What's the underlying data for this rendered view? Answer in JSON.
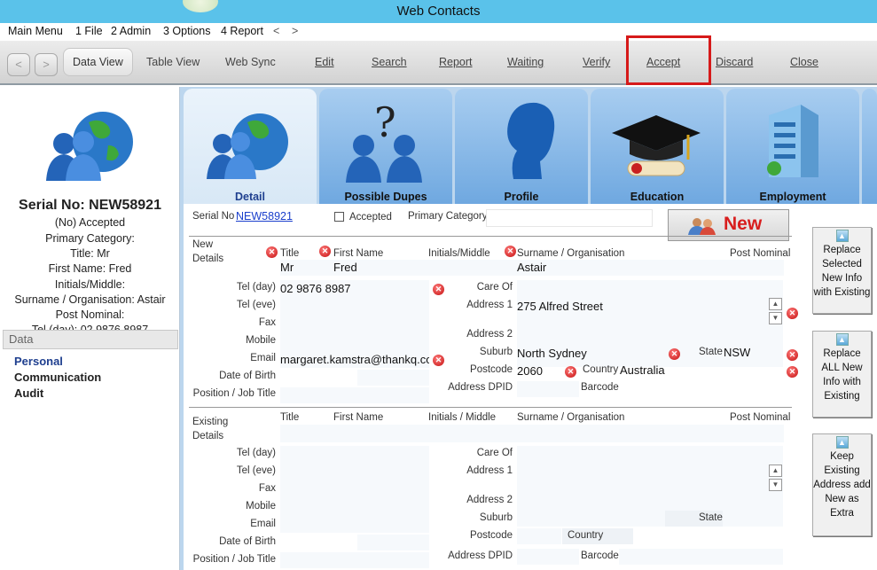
{
  "window": {
    "title": "Web Contacts"
  },
  "menu": [
    "Main Menu",
    "1 File",
    "2 Admin",
    "3 Options",
    "4 Report",
    "<",
    ">"
  ],
  "toolbar": {
    "back": "<",
    "forward": ">",
    "items": [
      "Data View",
      "Table View",
      "Web Sync",
      "Edit",
      "Search",
      "Report",
      "Waiting",
      "Verify",
      "Accept",
      "Discard",
      "Close"
    ]
  },
  "left": {
    "serial": "Serial No: NEW58921",
    "lines": [
      "(No) Accepted",
      "Primary Category:",
      "Title: Mr",
      "First Name: Fred",
      "Initials/Middle:",
      "Surname / Organisation: Astair",
      "Post Nominal:",
      "Tel (day): 02 9876 8987"
    ],
    "data_header": "Data",
    "nav": [
      "Personal",
      "Communication",
      "Audit"
    ]
  },
  "tabs": [
    "Detail",
    "Possible Dupes",
    "Profile",
    "Education",
    "Employment"
  ],
  "form": {
    "serial_label": "Serial No",
    "serial_value": "NEW58921",
    "accepted_label": "Accepted",
    "primary_category_label": "Primary Category",
    "new_button": "New",
    "new_details_label": "New\nDetails",
    "existing_details_label": "Existing\nDetails",
    "col_title": "Title",
    "col_first": "First Name",
    "col_initials": "Initials/Middle",
    "col_initials2": "Initials / Middle",
    "col_surname": "Surname / Organisation",
    "col_postnom": "Post Nominal",
    "title_val": "Mr",
    "first_val": "Fred",
    "surname_val": "Astair",
    "labels_left": [
      "Tel (day)",
      "Tel (eve)",
      "Fax",
      "Mobile",
      "Email",
      "Date of Birth",
      "Position / Job Title"
    ],
    "labels_right": [
      "Care Of",
      "Address 1",
      "Address 2",
      "Suburb",
      "State",
      "Postcode",
      "Country",
      "Address DPID",
      "Barcode"
    ],
    "tel_day": "02 9876 8987",
    "email": "margaret.kamstra@thankq.com",
    "address1": "275 Alfred Street",
    "suburb": "North Sydney",
    "state": "NSW",
    "postcode": "2060",
    "country": "Australia"
  },
  "side_buttons": [
    {
      "label": "Replace Selected New Info with Existing"
    },
    {
      "label": "Replace ALL New Info with Existing"
    },
    {
      "label": "Keep Existing Address add New as Extra"
    }
  ]
}
